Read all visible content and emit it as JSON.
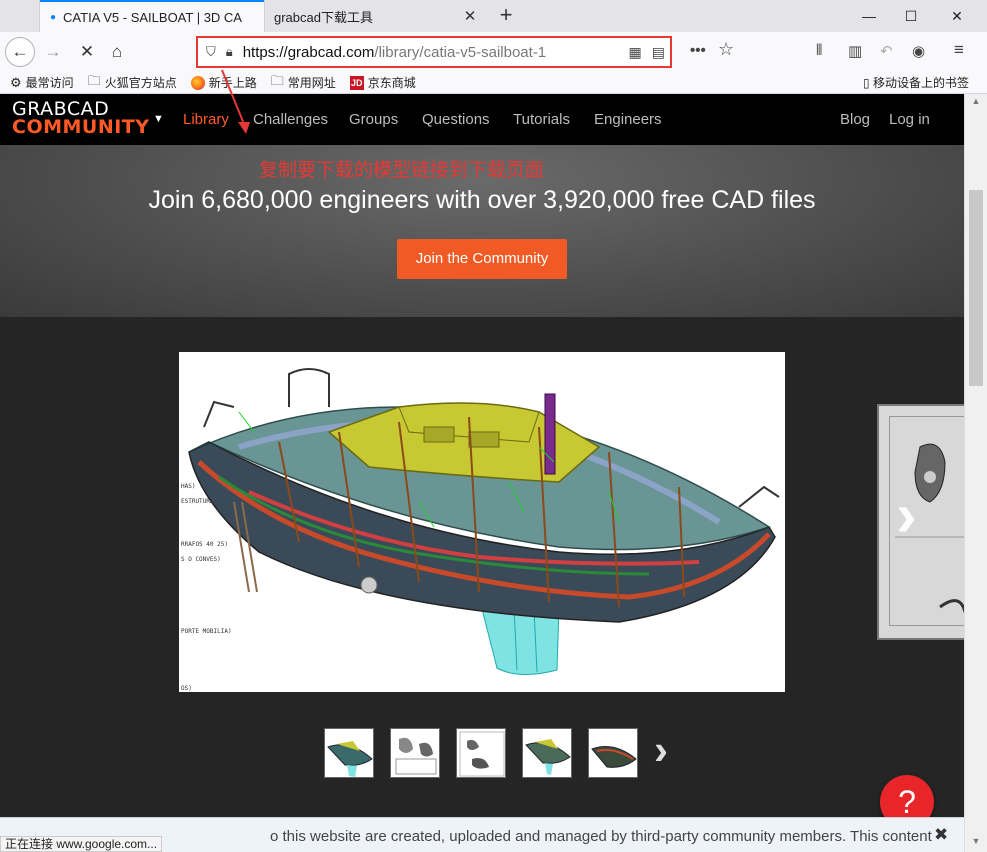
{
  "browser": {
    "tabs": [
      {
        "title": "CATIA V5 - SAILBOAT | 3D CA",
        "active": true
      },
      {
        "title": "grabcad下载工具",
        "active": false
      }
    ],
    "window_controls": {
      "minimize": "—",
      "maximize": "☐",
      "close": "✕"
    },
    "url": {
      "domain": "https://grabcad.com",
      "path": "/library/catia-v5-sailboat-1"
    },
    "toolbar_icons": [
      "back-icon",
      "forward-icon",
      "stop-icon",
      "home-icon",
      "shield-icon",
      "lock-icon",
      "qr-icon",
      "reader-icon",
      "more-icon",
      "star-icon",
      "library-icon",
      "sidebar-icon",
      "undo-icon",
      "account-icon",
      "menu-icon"
    ],
    "bookmarks": [
      {
        "label": "最常访问",
        "icon": "gear-icon"
      },
      {
        "label": "火狐官方站点",
        "icon": "folder-icon"
      },
      {
        "label": "新手上路",
        "icon": "firefox-icon"
      },
      {
        "label": "常用网址",
        "icon": "folder-icon"
      },
      {
        "label": "京东商城",
        "icon": "jd-icon"
      }
    ],
    "jd_label": "JD",
    "mobile_bookmarks": "移动设备上的书签",
    "status": "正在连接 www.google.com..."
  },
  "site": {
    "logo_top": "GRABCAD",
    "logo_bottom": "COMMUNITY",
    "nav": [
      {
        "label": "Library",
        "active": true
      },
      {
        "label": "Challenges"
      },
      {
        "label": "Groups"
      },
      {
        "label": "Questions"
      },
      {
        "label": "Tutorials"
      },
      {
        "label": "Engineers"
      }
    ],
    "nav_right": [
      {
        "label": "Blog"
      },
      {
        "label": "Log in"
      }
    ],
    "annotation": "复制要下载的模型链接到下载页面",
    "hero_title": "Join 6,680,000 engineers with over 3,920,000 free CAD files",
    "join_button": "Join the Community",
    "drawing_labels": [
      "HAS)",
      "ESTRUTURA)",
      "RRAFOS 40 25)",
      "S O CONVES)",
      "PORTE MOBILIA)",
      "OS)"
    ],
    "notice": "o this website are created, uploaded and managed by third-party community members. This content",
    "help": "?"
  },
  "colors": {
    "accent": "#ff5a26",
    "annotation": "#e53935",
    "tab_accent": "#0a84ff",
    "help": "#e8262a"
  }
}
